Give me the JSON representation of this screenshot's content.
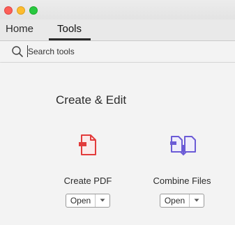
{
  "tabs": [
    {
      "label": "Home",
      "active": false
    },
    {
      "label": "Tools",
      "active": true
    }
  ],
  "search": {
    "placeholder": "Search tools",
    "value": ""
  },
  "section": {
    "title": "Create & Edit"
  },
  "tools": [
    {
      "name": "Create PDF",
      "open_label": "Open",
      "icon": "create-pdf-icon",
      "color": "#e23b3b"
    },
    {
      "name": "Combine Files",
      "open_label": "Open",
      "icon": "combine-files-icon",
      "color": "#6b5bd6"
    }
  ]
}
